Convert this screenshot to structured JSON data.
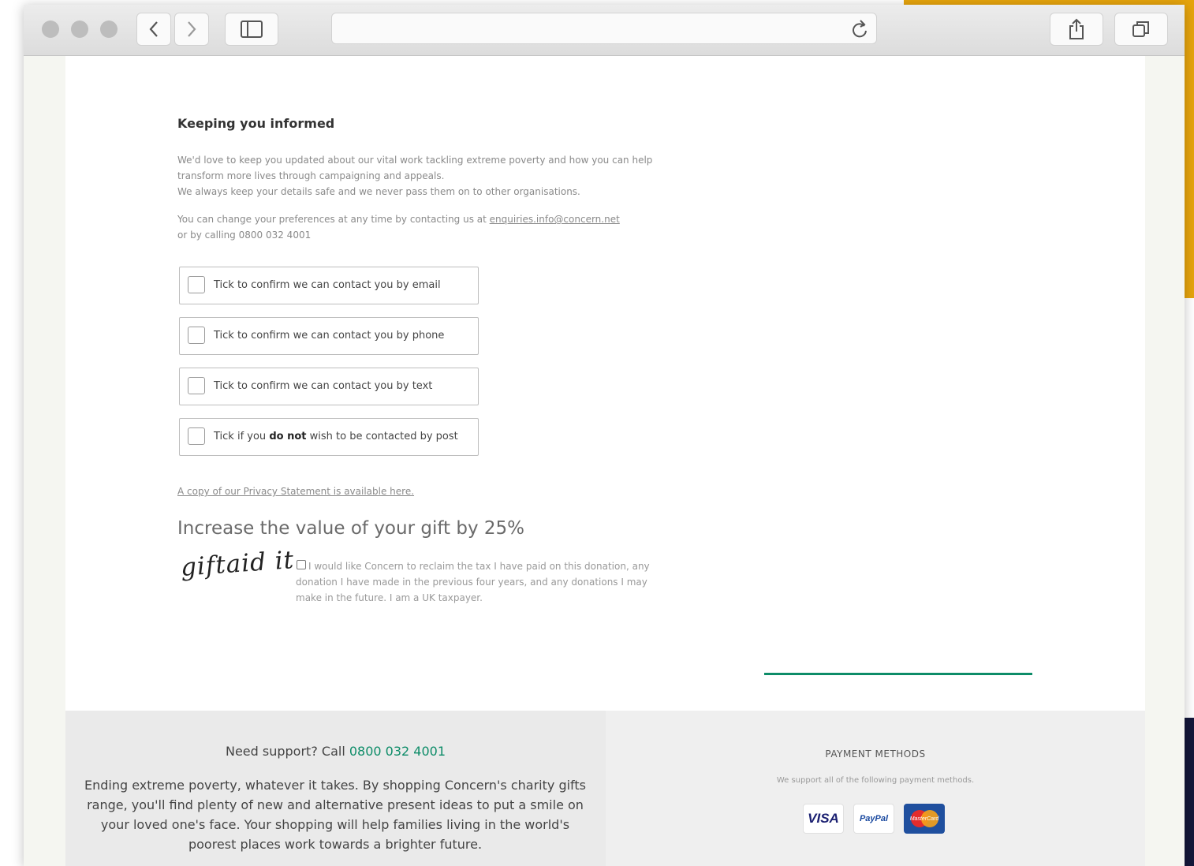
{
  "browser": {
    "icons": [
      "back-icon",
      "forward-icon",
      "sidebar-icon",
      "reload-icon",
      "share-icon",
      "tabs-icon"
    ]
  },
  "section": {
    "heading": "Keeping you informed",
    "intro_1": "We'd love to keep you updated about our vital work tackling extreme poverty and how you can help transform more lives through campaigning and appeals.",
    "intro_2": "We always keep your details safe and we never pass them on to other organisations.",
    "prefs_text": "You can change your preferences at any time by contacting us at ",
    "prefs_email": "enquiries.info@concern.net",
    "prefs_text_2": "or by calling 0800 032 4001"
  },
  "options": [
    {
      "label": "Tick to confirm we can contact you by email"
    },
    {
      "label": "Tick to confirm we can contact you by phone"
    },
    {
      "label": "Tick to confirm we can contact you by text"
    }
  ],
  "post_option": {
    "before": "Tick if you ",
    "bold": "do not",
    "after": " wish to be contacted by post"
  },
  "privacy_link": "A copy of our Privacy Statement is available here.",
  "gift_aid": {
    "heading": "Increase the value of your gift by 25%",
    "logo": "giftaid it",
    "text": "I would like Concern to reclaim the tax I have paid on this donation, any donation I have made in the previous four years, and any donations I may make in the future. I am a UK taxpayer."
  },
  "footer": {
    "support_prefix": "Need support? Call ",
    "support_phone": "0800 032 4001",
    "blurb": "Ending extreme poverty, whatever it takes. By shopping Concern's charity gifts range, you'll find plenty of new and alternative present ideas to put a smile on your loved one's face. Your shopping will help families living in the world's poorest places work towards a brighter future.",
    "payment_title": "PAYMENT METHODS",
    "payment_sub": "We support all of the following payment methods.",
    "cards": {
      "visa": "VISA",
      "paypal": "PayPal",
      "mastercard": "MasterCard"
    }
  },
  "colors": {
    "accent": "#0d8c68",
    "deco_yellow": "#e6a40c",
    "deco_navy": "#14173a"
  }
}
